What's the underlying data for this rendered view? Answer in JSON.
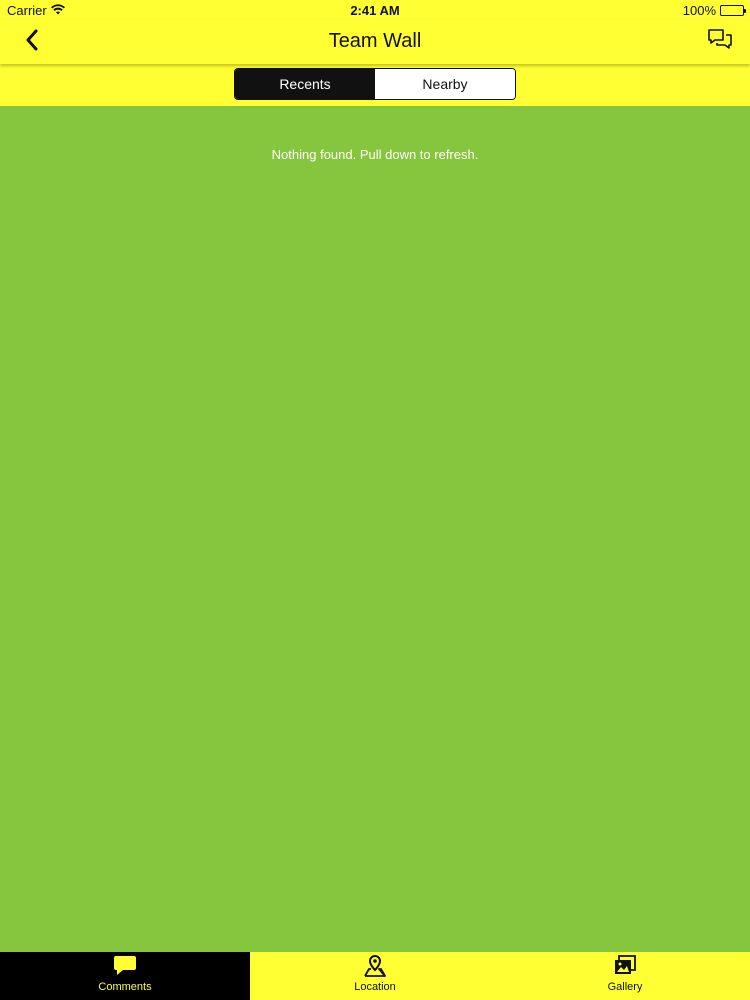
{
  "status_bar": {
    "carrier": "Carrier",
    "time": "2:41 AM",
    "battery": "100%"
  },
  "nav": {
    "title": "Team Wall",
    "back_icon": "chevron-left-icon",
    "chat_icon": "chat-bubbles-icon"
  },
  "segments": [
    {
      "label": "Recents",
      "selected": true
    },
    {
      "label": "Nearby",
      "selected": false
    }
  ],
  "content": {
    "empty_message": "Nothing found. Pull down to refresh."
  },
  "tabs": [
    {
      "label": "Comments",
      "icon": "comment-icon",
      "selected": true
    },
    {
      "label": "Location",
      "icon": "location-pin-icon",
      "selected": false
    },
    {
      "label": "Gallery",
      "icon": "gallery-icon",
      "selected": false
    }
  ],
  "colors": {
    "accent_yellow": "#FFFF33",
    "background_green": "#86C63F",
    "dark": "#111111"
  }
}
